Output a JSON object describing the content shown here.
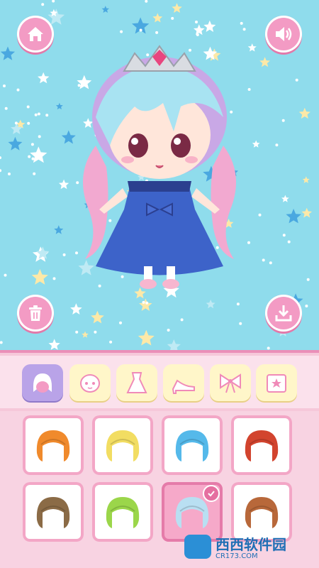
{
  "stage": {
    "background_color": "#8fdcec",
    "buttons": {
      "home_icon": "home-icon",
      "sound_icon": "speaker-icon",
      "delete_icon": "trash-icon",
      "save_icon": "download-icon"
    }
  },
  "tabs": [
    {
      "name": "hair",
      "icon": "hair-icon",
      "active": true
    },
    {
      "name": "face",
      "icon": "face-icon",
      "active": false
    },
    {
      "name": "dress",
      "icon": "dress-icon",
      "active": false
    },
    {
      "name": "shoes",
      "icon": "high-heel-icon",
      "active": false
    },
    {
      "name": "accessory",
      "icon": "bow-icon",
      "active": false
    },
    {
      "name": "background",
      "icon": "frame-star-icon",
      "active": false
    }
  ],
  "hair_items": [
    {
      "color": "#f08a2c",
      "selected": false
    },
    {
      "color": "#f2dd62",
      "selected": false
    },
    {
      "color": "#55b9ea",
      "selected": false
    },
    {
      "color": "#d2442e",
      "selected": false
    },
    {
      "color": "#8b6b46",
      "selected": false
    },
    {
      "color": "#9bd64a",
      "selected": false
    },
    {
      "color": "#b9dff2",
      "selected": true
    },
    {
      "color": "#b8683a",
      "selected": false
    }
  ],
  "colors": {
    "accent_pink": "#f39bc4",
    "panel_pink": "#f6c8da",
    "tab_yellow": "#fff6c9",
    "tab_active_purple": "#b9a3e8"
  },
  "watermark": {
    "text": "西西软件园",
    "sub": "CR173.COM"
  }
}
